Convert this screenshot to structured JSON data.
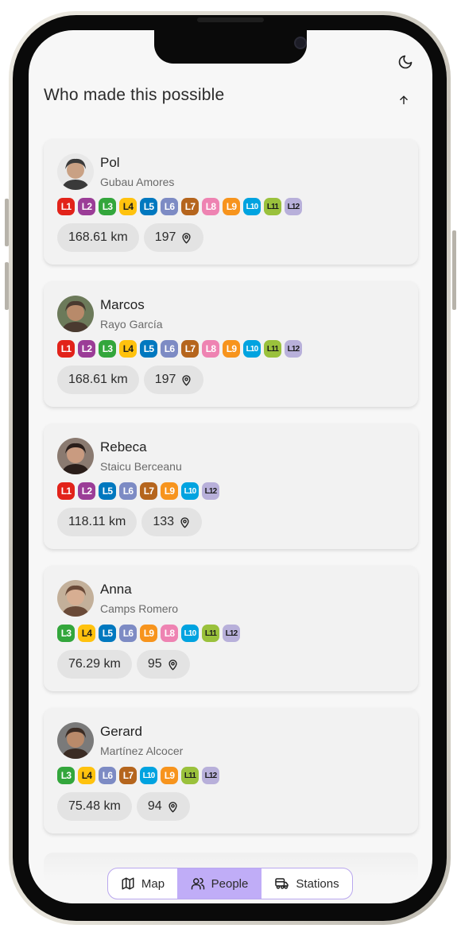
{
  "header": {
    "title": "Who made this possible",
    "theme_icon": "moon-icon",
    "scroll_icon": "arrow-up-icon"
  },
  "line_colors": {
    "L1": "#e2231a",
    "L2": "#9b3d97",
    "L3": "#33a63c",
    "L4": "#ffc20e",
    "L5": "#0078bf",
    "L6": "#7d8bc4",
    "L7": "#b5651d",
    "L8": "#ee83b2",
    "L9": "#f7941d",
    "L10": "#00a3e0",
    "L11": "#9ac13c",
    "L12": "#b8b0da"
  },
  "people": [
    {
      "first_name": "Pol",
      "last_name": "Gubau Amores",
      "lines": [
        "L1",
        "L2",
        "L3",
        "L4",
        "L5",
        "L6",
        "L7",
        "L8",
        "L9",
        "L10",
        "L11",
        "L12"
      ],
      "distance": "168.61 km",
      "stations": "197"
    },
    {
      "first_name": "Marcos",
      "last_name": "Rayo García",
      "lines": [
        "L1",
        "L2",
        "L3",
        "L4",
        "L5",
        "L6",
        "L7",
        "L8",
        "L9",
        "L10",
        "L11",
        "L12"
      ],
      "distance": "168.61 km",
      "stations": "197"
    },
    {
      "first_name": "Rebeca",
      "last_name": "Staicu Berceanu",
      "lines": [
        "L1",
        "L2",
        "L5",
        "L6",
        "L7",
        "L9",
        "L10",
        "L12"
      ],
      "distance": "118.11 km",
      "stations": "133"
    },
    {
      "first_name": "Anna",
      "last_name": "Camps Romero",
      "lines": [
        "L3",
        "L4",
        "L5",
        "L6",
        "L9",
        "L8",
        "L10",
        "L11",
        "L12"
      ],
      "distance": "76.29 km",
      "stations": "95"
    },
    {
      "first_name": "Gerard",
      "last_name": "Martínez Alcocer",
      "lines": [
        "L3",
        "L4",
        "L6",
        "L7",
        "L10",
        "L9",
        "L11",
        "L12"
      ],
      "distance": "75.48 km",
      "stations": "94"
    }
  ],
  "nav": {
    "active": "People",
    "items": [
      {
        "label": "Map",
        "icon": "map-icon"
      },
      {
        "label": "People",
        "icon": "users-icon"
      },
      {
        "label": "Stations",
        "icon": "train-icon"
      }
    ]
  }
}
